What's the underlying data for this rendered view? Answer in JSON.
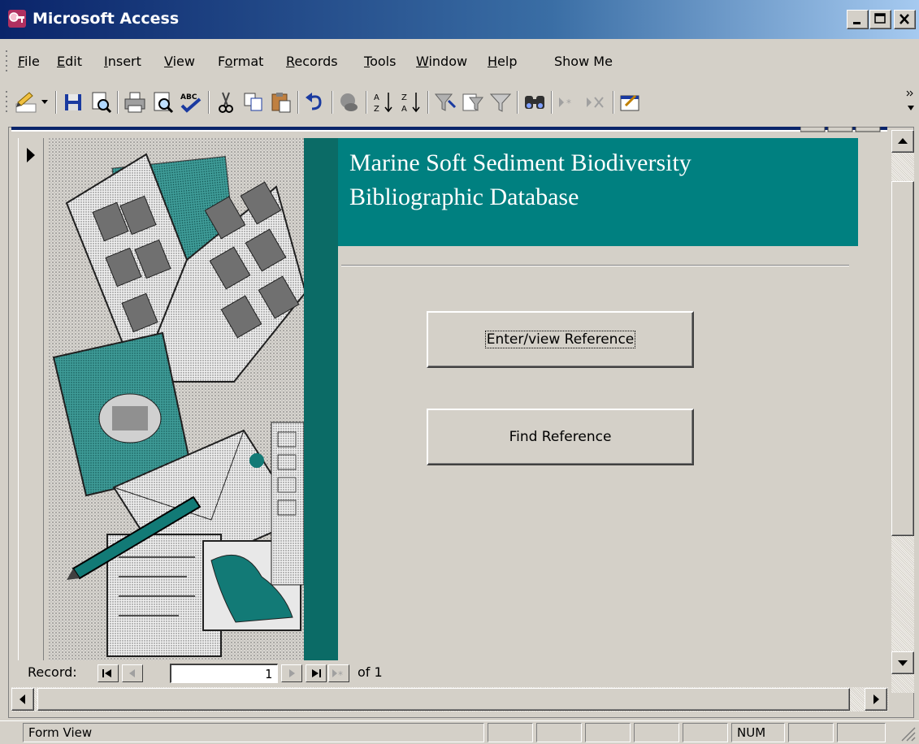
{
  "window": {
    "title": "Microsoft Access",
    "icon": "access-key-icon",
    "controls": [
      "minimize-icon",
      "maximize-icon",
      "close-icon"
    ]
  },
  "menu": [
    {
      "label": "File",
      "u": "F"
    },
    {
      "label": "Edit",
      "u": "E"
    },
    {
      "label": "Insert",
      "u": "I"
    },
    {
      "label": "View",
      "u": "V"
    },
    {
      "label": "Format",
      "u": "o"
    },
    {
      "label": "Records",
      "u": "R"
    },
    {
      "label": "Tools",
      "u": "T"
    },
    {
      "label": "Window",
      "u": "W"
    },
    {
      "label": "Help",
      "u": "H"
    },
    {
      "label": "Show Me",
      "u": ""
    }
  ],
  "toolbar": {
    "icons": [
      "view-design-icon",
      "dropdown-arrow-icon",
      "save-icon",
      "file-search-icon",
      "print-icon",
      "print-preview-icon",
      "spelling-icon",
      "cut-icon",
      "copy-icon",
      "paste-icon",
      "undo-icon",
      "hyperlink-icon",
      "sort-ascending-icon",
      "sort-descending-icon",
      "filter-by-selection-icon",
      "filter-by-form-icon",
      "apply-filter-icon",
      "find-icon",
      "new-record-icon",
      "delete-record-icon",
      "properties-icon"
    ]
  },
  "form": {
    "title_line1": "Marine Soft Sediment Biodiversity",
    "title_line2": "Bibliographic Database",
    "buttons": {
      "enter": "Enter/view Reference",
      "find": "Find Reference"
    },
    "header_color": "#008080",
    "picture": "clipart-open-book-and-papers"
  },
  "record_nav": {
    "label": "Record:",
    "current": "1",
    "of_text": "of  1"
  },
  "status": {
    "mode": "Form View",
    "num": "NUM"
  }
}
